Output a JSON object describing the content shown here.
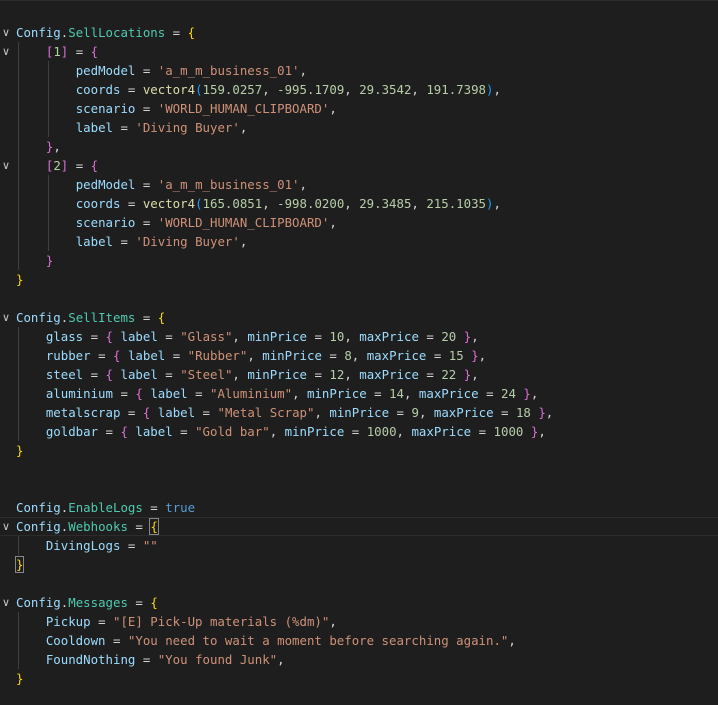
{
  "editor": {
    "lines": [
      {
        "fold": "∨",
        "tokens": [
          {
            "t": "Config",
            "c": "id"
          },
          {
            "t": ".",
            "c": "op"
          },
          {
            "t": "SellLocations",
            "c": "prop"
          },
          {
            "t": " = ",
            "c": "op"
          },
          {
            "t": "{",
            "c": "b1"
          }
        ]
      },
      {
        "fold": "∨",
        "tokens": [
          {
            "t": "    ",
            "c": "op"
          },
          {
            "t": "[",
            "c": "b2"
          },
          {
            "t": "1",
            "c": "num"
          },
          {
            "t": "]",
            "c": "b2"
          },
          {
            "t": " = ",
            "c": "op"
          },
          {
            "t": "{",
            "c": "b2"
          }
        ]
      },
      {
        "fold": "",
        "tokens": [
          {
            "t": "        ",
            "c": "op"
          },
          {
            "t": "pedModel",
            "c": "id"
          },
          {
            "t": " = ",
            "c": "op"
          },
          {
            "t": "'a_m_m_business_01'",
            "c": "str"
          },
          {
            "t": ",",
            "c": "op"
          }
        ]
      },
      {
        "fold": "",
        "tokens": [
          {
            "t": "        ",
            "c": "op"
          },
          {
            "t": "coords",
            "c": "id"
          },
          {
            "t": " = ",
            "c": "op"
          },
          {
            "t": "vector4",
            "c": "fn"
          },
          {
            "t": "(",
            "c": "b3"
          },
          {
            "t": "159.0257",
            "c": "num"
          },
          {
            "t": ", ",
            "c": "op"
          },
          {
            "t": "-995.1709",
            "c": "num"
          },
          {
            "t": ", ",
            "c": "op"
          },
          {
            "t": "29.3542",
            "c": "num"
          },
          {
            "t": ", ",
            "c": "op"
          },
          {
            "t": "191.7398",
            "c": "num"
          },
          {
            "t": ")",
            "c": "b3"
          },
          {
            "t": ",",
            "c": "op"
          }
        ]
      },
      {
        "fold": "",
        "tokens": [
          {
            "t": "        ",
            "c": "op"
          },
          {
            "t": "scenario",
            "c": "id"
          },
          {
            "t": " = ",
            "c": "op"
          },
          {
            "t": "'WORLD_HUMAN_CLIPBOARD'",
            "c": "str"
          },
          {
            "t": ",",
            "c": "op"
          }
        ]
      },
      {
        "fold": "",
        "tokens": [
          {
            "t": "        ",
            "c": "op"
          },
          {
            "t": "label",
            "c": "id"
          },
          {
            "t": " = ",
            "c": "op"
          },
          {
            "t": "'Diving Buyer'",
            "c": "str"
          },
          {
            "t": ",",
            "c": "op"
          }
        ]
      },
      {
        "fold": "",
        "tokens": [
          {
            "t": "    ",
            "c": "op"
          },
          {
            "t": "}",
            "c": "b2"
          },
          {
            "t": ",",
            "c": "op"
          }
        ]
      },
      {
        "fold": "∨",
        "tokens": [
          {
            "t": "    ",
            "c": "op"
          },
          {
            "t": "[",
            "c": "b2"
          },
          {
            "t": "2",
            "c": "num"
          },
          {
            "t": "]",
            "c": "b2"
          },
          {
            "t": " = ",
            "c": "op"
          },
          {
            "t": "{",
            "c": "b2"
          }
        ]
      },
      {
        "fold": "",
        "tokens": [
          {
            "t": "        ",
            "c": "op"
          },
          {
            "t": "pedModel",
            "c": "id"
          },
          {
            "t": " = ",
            "c": "op"
          },
          {
            "t": "'a_m_m_business_01'",
            "c": "str"
          },
          {
            "t": ",",
            "c": "op"
          }
        ]
      },
      {
        "fold": "",
        "tokens": [
          {
            "t": "        ",
            "c": "op"
          },
          {
            "t": "coords",
            "c": "id"
          },
          {
            "t": " = ",
            "c": "op"
          },
          {
            "t": "vector4",
            "c": "fn"
          },
          {
            "t": "(",
            "c": "b3"
          },
          {
            "t": "165.0851",
            "c": "num"
          },
          {
            "t": ", ",
            "c": "op"
          },
          {
            "t": "-998.0200",
            "c": "num"
          },
          {
            "t": ", ",
            "c": "op"
          },
          {
            "t": "29.3485",
            "c": "num"
          },
          {
            "t": ", ",
            "c": "op"
          },
          {
            "t": "215.1035",
            "c": "num"
          },
          {
            "t": ")",
            "c": "b3"
          },
          {
            "t": ",",
            "c": "op"
          }
        ]
      },
      {
        "fold": "",
        "tokens": [
          {
            "t": "        ",
            "c": "op"
          },
          {
            "t": "scenario",
            "c": "id"
          },
          {
            "t": " = ",
            "c": "op"
          },
          {
            "t": "'WORLD_HUMAN_CLIPBOARD'",
            "c": "str"
          },
          {
            "t": ",",
            "c": "op"
          }
        ]
      },
      {
        "fold": "",
        "tokens": [
          {
            "t": "        ",
            "c": "op"
          },
          {
            "t": "label",
            "c": "id"
          },
          {
            "t": " = ",
            "c": "op"
          },
          {
            "t": "'Diving Buyer'",
            "c": "str"
          },
          {
            "t": ",",
            "c": "op"
          }
        ]
      },
      {
        "fold": "",
        "tokens": [
          {
            "t": "    ",
            "c": "op"
          },
          {
            "t": "}",
            "c": "b2"
          }
        ]
      },
      {
        "fold": "",
        "tokens": [
          {
            "t": "}",
            "c": "b1"
          }
        ]
      },
      {
        "fold": "",
        "tokens": []
      },
      {
        "fold": "∨",
        "tokens": [
          {
            "t": "Config",
            "c": "id"
          },
          {
            "t": ".",
            "c": "op"
          },
          {
            "t": "SellItems",
            "c": "prop"
          },
          {
            "t": " = ",
            "c": "op"
          },
          {
            "t": "{",
            "c": "b1"
          }
        ]
      },
      {
        "fold": "",
        "tokens": [
          {
            "t": "    ",
            "c": "op"
          },
          {
            "t": "glass",
            "c": "id"
          },
          {
            "t": " = ",
            "c": "op"
          },
          {
            "t": "{",
            "c": "b2"
          },
          {
            "t": " ",
            "c": "op"
          },
          {
            "t": "label",
            "c": "id"
          },
          {
            "t": " = ",
            "c": "op"
          },
          {
            "t": "\"Glass\"",
            "c": "str"
          },
          {
            "t": ", ",
            "c": "op"
          },
          {
            "t": "minPrice",
            "c": "id"
          },
          {
            "t": " = ",
            "c": "op"
          },
          {
            "t": "10",
            "c": "num"
          },
          {
            "t": ", ",
            "c": "op"
          },
          {
            "t": "maxPrice",
            "c": "id"
          },
          {
            "t": " = ",
            "c": "op"
          },
          {
            "t": "20",
            "c": "num"
          },
          {
            "t": " ",
            "c": "op"
          },
          {
            "t": "}",
            "c": "b2"
          },
          {
            "t": ",",
            "c": "op"
          }
        ]
      },
      {
        "fold": "",
        "tokens": [
          {
            "t": "    ",
            "c": "op"
          },
          {
            "t": "rubber",
            "c": "id"
          },
          {
            "t": " = ",
            "c": "op"
          },
          {
            "t": "{",
            "c": "b2"
          },
          {
            "t": " ",
            "c": "op"
          },
          {
            "t": "label",
            "c": "id"
          },
          {
            "t": " = ",
            "c": "op"
          },
          {
            "t": "\"Rubber\"",
            "c": "str"
          },
          {
            "t": ", ",
            "c": "op"
          },
          {
            "t": "minPrice",
            "c": "id"
          },
          {
            "t": " = ",
            "c": "op"
          },
          {
            "t": "8",
            "c": "num"
          },
          {
            "t": ", ",
            "c": "op"
          },
          {
            "t": "maxPrice",
            "c": "id"
          },
          {
            "t": " = ",
            "c": "op"
          },
          {
            "t": "15",
            "c": "num"
          },
          {
            "t": " ",
            "c": "op"
          },
          {
            "t": "}",
            "c": "b2"
          },
          {
            "t": ",",
            "c": "op"
          }
        ]
      },
      {
        "fold": "",
        "tokens": [
          {
            "t": "    ",
            "c": "op"
          },
          {
            "t": "steel",
            "c": "id"
          },
          {
            "t": " = ",
            "c": "op"
          },
          {
            "t": "{",
            "c": "b2"
          },
          {
            "t": " ",
            "c": "op"
          },
          {
            "t": "label",
            "c": "id"
          },
          {
            "t": " = ",
            "c": "op"
          },
          {
            "t": "\"Steel\"",
            "c": "str"
          },
          {
            "t": ", ",
            "c": "op"
          },
          {
            "t": "minPrice",
            "c": "id"
          },
          {
            "t": " = ",
            "c": "op"
          },
          {
            "t": "12",
            "c": "num"
          },
          {
            "t": ", ",
            "c": "op"
          },
          {
            "t": "maxPrice",
            "c": "id"
          },
          {
            "t": " = ",
            "c": "op"
          },
          {
            "t": "22",
            "c": "num"
          },
          {
            "t": " ",
            "c": "op"
          },
          {
            "t": "}",
            "c": "b2"
          },
          {
            "t": ",",
            "c": "op"
          }
        ]
      },
      {
        "fold": "",
        "tokens": [
          {
            "t": "    ",
            "c": "op"
          },
          {
            "t": "aluminium",
            "c": "id"
          },
          {
            "t": " = ",
            "c": "op"
          },
          {
            "t": "{",
            "c": "b2"
          },
          {
            "t": " ",
            "c": "op"
          },
          {
            "t": "label",
            "c": "id"
          },
          {
            "t": " = ",
            "c": "op"
          },
          {
            "t": "\"Aluminium\"",
            "c": "str"
          },
          {
            "t": ", ",
            "c": "op"
          },
          {
            "t": "minPrice",
            "c": "id"
          },
          {
            "t": " = ",
            "c": "op"
          },
          {
            "t": "14",
            "c": "num"
          },
          {
            "t": ", ",
            "c": "op"
          },
          {
            "t": "maxPrice",
            "c": "id"
          },
          {
            "t": " = ",
            "c": "op"
          },
          {
            "t": "24",
            "c": "num"
          },
          {
            "t": " ",
            "c": "op"
          },
          {
            "t": "}",
            "c": "b2"
          },
          {
            "t": ",",
            "c": "op"
          }
        ]
      },
      {
        "fold": "",
        "tokens": [
          {
            "t": "    ",
            "c": "op"
          },
          {
            "t": "metalscrap",
            "c": "id"
          },
          {
            "t": " = ",
            "c": "op"
          },
          {
            "t": "{",
            "c": "b2"
          },
          {
            "t": " ",
            "c": "op"
          },
          {
            "t": "label",
            "c": "id"
          },
          {
            "t": " = ",
            "c": "op"
          },
          {
            "t": "\"Metal Scrap\"",
            "c": "str"
          },
          {
            "t": ", ",
            "c": "op"
          },
          {
            "t": "minPrice",
            "c": "id"
          },
          {
            "t": " = ",
            "c": "op"
          },
          {
            "t": "9",
            "c": "num"
          },
          {
            "t": ", ",
            "c": "op"
          },
          {
            "t": "maxPrice",
            "c": "id"
          },
          {
            "t": " = ",
            "c": "op"
          },
          {
            "t": "18",
            "c": "num"
          },
          {
            "t": " ",
            "c": "op"
          },
          {
            "t": "}",
            "c": "b2"
          },
          {
            "t": ",",
            "c": "op"
          }
        ]
      },
      {
        "fold": "",
        "tokens": [
          {
            "t": "    ",
            "c": "op"
          },
          {
            "t": "goldbar",
            "c": "id"
          },
          {
            "t": " = ",
            "c": "op"
          },
          {
            "t": "{",
            "c": "b2"
          },
          {
            "t": " ",
            "c": "op"
          },
          {
            "t": "label",
            "c": "id"
          },
          {
            "t": " = ",
            "c": "op"
          },
          {
            "t": "\"Gold bar\"",
            "c": "str"
          },
          {
            "t": ", ",
            "c": "op"
          },
          {
            "t": "minPrice",
            "c": "id"
          },
          {
            "t": " = ",
            "c": "op"
          },
          {
            "t": "1000",
            "c": "num"
          },
          {
            "t": ", ",
            "c": "op"
          },
          {
            "t": "maxPrice",
            "c": "id"
          },
          {
            "t": " = ",
            "c": "op"
          },
          {
            "t": "1000",
            "c": "num"
          },
          {
            "t": " ",
            "c": "op"
          },
          {
            "t": "}",
            "c": "b2"
          },
          {
            "t": ",",
            "c": "op"
          }
        ]
      },
      {
        "fold": "",
        "tokens": [
          {
            "t": "}",
            "c": "b1"
          }
        ]
      },
      {
        "fold": "",
        "tokens": []
      },
      {
        "fold": "",
        "tokens": []
      },
      {
        "fold": "",
        "tokens": [
          {
            "t": "Config",
            "c": "id"
          },
          {
            "t": ".",
            "c": "op"
          },
          {
            "t": "EnableLogs",
            "c": "prop"
          },
          {
            "t": " = ",
            "c": "op"
          },
          {
            "t": "true",
            "c": "kw"
          }
        ]
      },
      {
        "fold": "∨",
        "highlight": true,
        "tokens": [
          {
            "t": "Config",
            "c": "id"
          },
          {
            "t": ".",
            "c": "op"
          },
          {
            "t": "Webhooks",
            "c": "prop"
          },
          {
            "t": " = ",
            "c": "op"
          },
          {
            "t": "{",
            "c": "b1",
            "box": true
          }
        ]
      },
      {
        "fold": "",
        "tokens": [
          {
            "t": "    ",
            "c": "op"
          },
          {
            "t": "DivingLogs",
            "c": "id"
          },
          {
            "t": " = ",
            "c": "op"
          },
          {
            "t": "\"\"",
            "c": "str"
          }
        ]
      },
      {
        "fold": "",
        "tokens": [
          {
            "t": "}",
            "c": "b1",
            "box": true
          }
        ]
      },
      {
        "fold": "",
        "tokens": []
      },
      {
        "fold": "∨",
        "tokens": [
          {
            "t": "Config",
            "c": "id"
          },
          {
            "t": ".",
            "c": "op"
          },
          {
            "t": "Messages",
            "c": "prop"
          },
          {
            "t": " = ",
            "c": "op"
          },
          {
            "t": "{",
            "c": "b1"
          }
        ]
      },
      {
        "fold": "",
        "tokens": [
          {
            "t": "    ",
            "c": "op"
          },
          {
            "t": "Pickup",
            "c": "id"
          },
          {
            "t": " = ",
            "c": "op"
          },
          {
            "t": "\"[E] Pick-Up materials (%dm)\"",
            "c": "str"
          },
          {
            "t": ",",
            "c": "op"
          }
        ]
      },
      {
        "fold": "",
        "tokens": [
          {
            "t": "    ",
            "c": "op"
          },
          {
            "t": "Cooldown",
            "c": "id"
          },
          {
            "t": " = ",
            "c": "op"
          },
          {
            "t": "\"You need to wait a moment before searching again.\"",
            "c": "str"
          },
          {
            "t": ",",
            "c": "op"
          }
        ]
      },
      {
        "fold": "",
        "tokens": [
          {
            "t": "    ",
            "c": "op"
          },
          {
            "t": "FoundNothing",
            "c": "id"
          },
          {
            "t": " = ",
            "c": "op"
          },
          {
            "t": "\"You found Junk\"",
            "c": "str"
          },
          {
            "t": ",",
            "c": "op"
          }
        ]
      },
      {
        "fold": "",
        "tokens": [
          {
            "t": "}",
            "c": "b1"
          }
        ]
      }
    ]
  },
  "colors": {
    "background": "#1e1e1e",
    "identifier": "#9cdcfe",
    "property": "#4ec9b0",
    "string": "#ce9178",
    "number": "#b5cea8",
    "function": "#dcdcaa",
    "keyword": "#569cd6",
    "bracket_level1": "#ffd700",
    "bracket_level2": "#da70d6",
    "bracket_level3": "#179fff"
  }
}
